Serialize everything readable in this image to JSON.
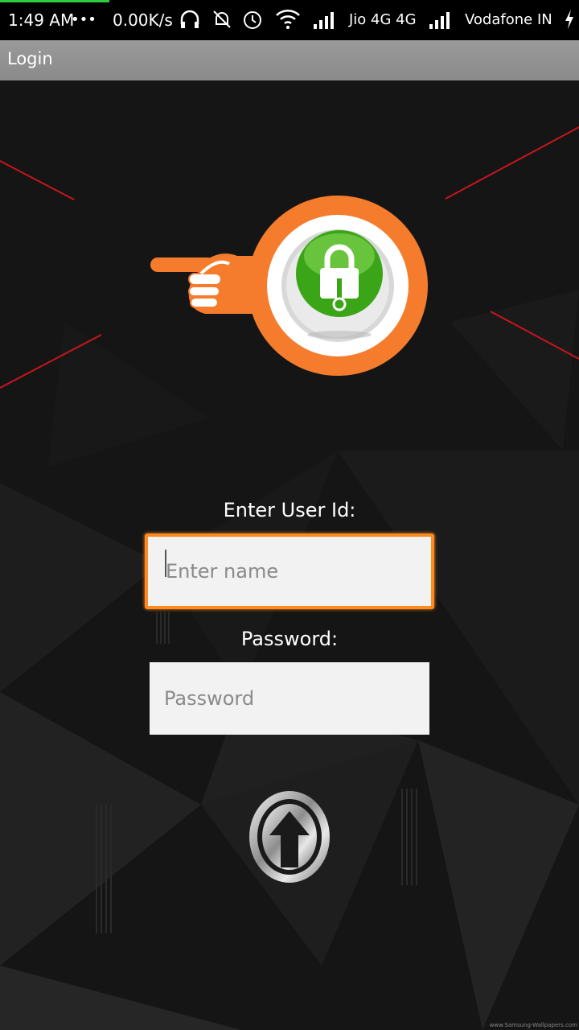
{
  "status_bar": {
    "time": "1:49 AM",
    "dots": "•••",
    "speed": "0.00K/s",
    "carrier1": "Jio 4G 4G",
    "carrier2": "Vodafone IN",
    "progress_color": "#2ecc40"
  },
  "action_bar": {
    "title": "Login"
  },
  "form": {
    "user_label": "Enter User Id:",
    "user_placeholder": "Enter name",
    "user_value": "",
    "password_label": "Password:",
    "password_placeholder": "Password",
    "password_value": "",
    "focus_color": "#ff8a1e"
  },
  "logo": {
    "accent_color": "#f47c2c",
    "lock_color": "#3aa516",
    "icons": [
      "pointing-hand-icon",
      "padlock-icon"
    ]
  },
  "submit": {
    "icon": "up-arrow-icon"
  },
  "watermark": "www.Samsung-Wallpapers.com"
}
